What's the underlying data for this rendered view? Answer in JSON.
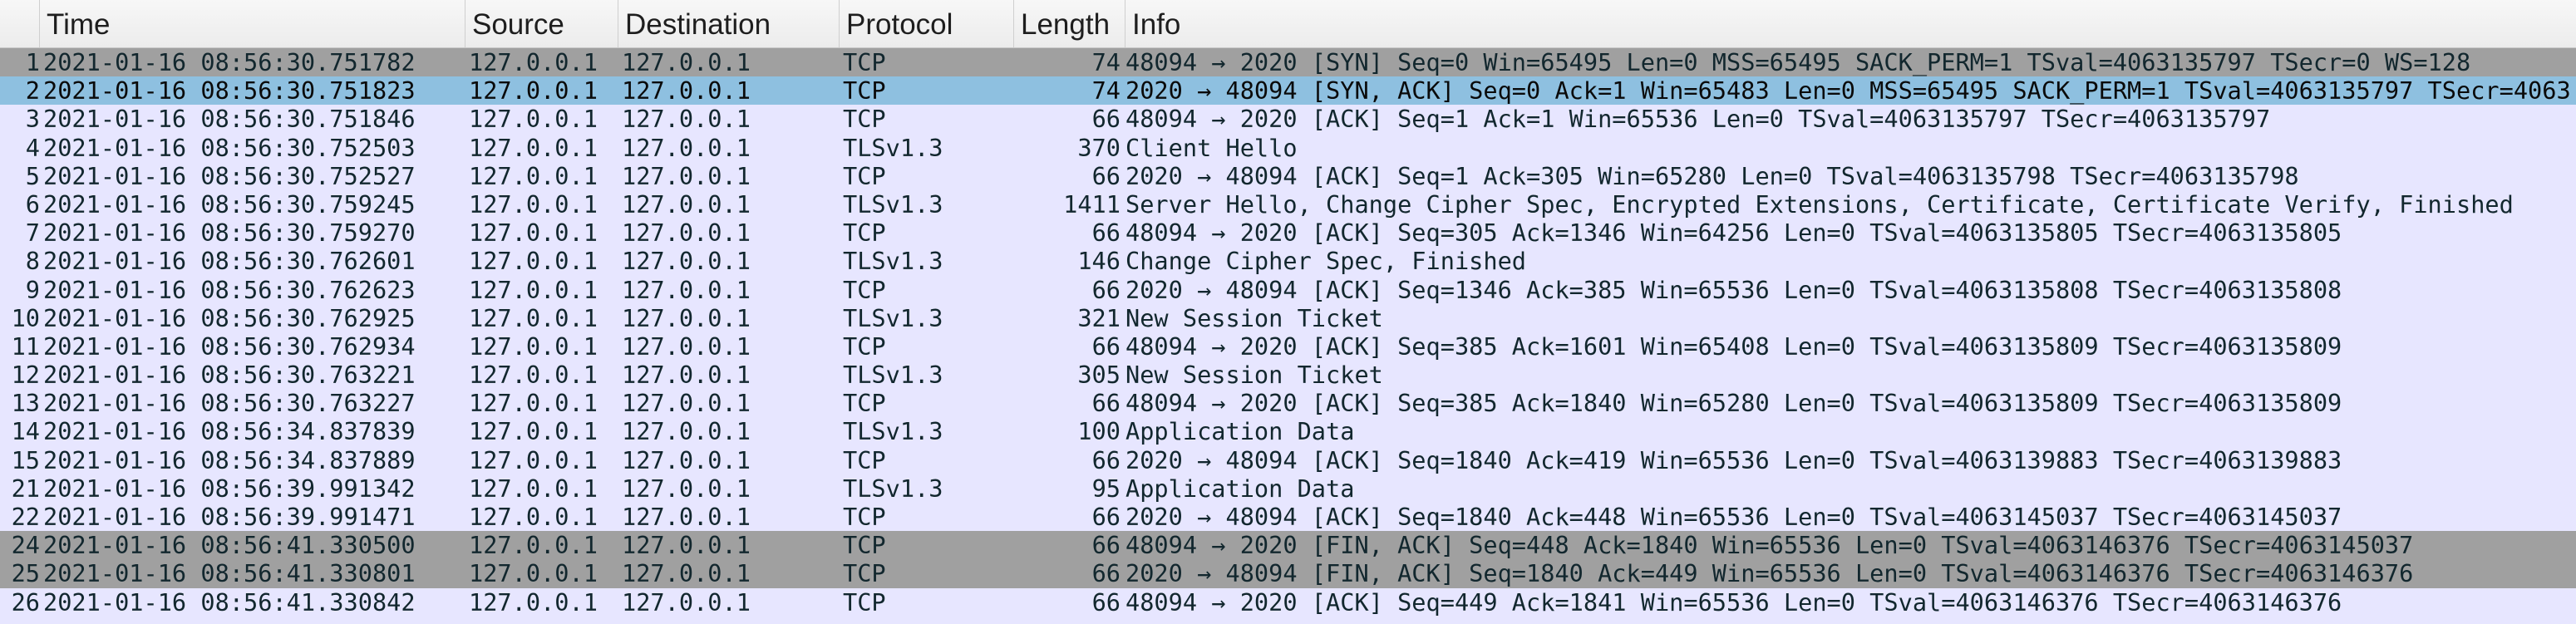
{
  "columns": {
    "no": "",
    "time": "Time",
    "source": "Source",
    "destination": "Destination",
    "protocol": "Protocol",
    "length": "Length",
    "info": "Info"
  },
  "colors": {
    "row_default": "#e7e6ff",
    "row_flag": "#a0a0a0",
    "row_selected": "#8ec0e0"
  },
  "packets": [
    {
      "no": "1",
      "time": "2021-01-16 08:56:30.751782",
      "source": "127.0.0.1",
      "destination": "127.0.0.1",
      "protocol": "TCP",
      "length": "74",
      "info": "48094 → 2020 [SYN] Seq=0 Win=65495 Len=0 MSS=65495 SACK_PERM=1 TSval=4063135797 TSecr=0 WS=128",
      "style": "flag"
    },
    {
      "no": "2",
      "time": "2021-01-16 08:56:30.751823",
      "source": "127.0.0.1",
      "destination": "127.0.0.1",
      "protocol": "TCP",
      "length": "74",
      "info": "2020 → 48094 [SYN, ACK] Seq=0 Ack=1 Win=65483 Len=0 MSS=65495 SACK_PERM=1 TSval=4063135797 TSecr=4063",
      "style": "selected"
    },
    {
      "no": "3",
      "time": "2021-01-16 08:56:30.751846",
      "source": "127.0.0.1",
      "destination": "127.0.0.1",
      "protocol": "TCP",
      "length": "66",
      "info": "48094 → 2020 [ACK] Seq=1 Ack=1 Win=65536 Len=0 TSval=4063135797 TSecr=4063135797",
      "style": "tcp"
    },
    {
      "no": "4",
      "time": "2021-01-16 08:56:30.752503",
      "source": "127.0.0.1",
      "destination": "127.0.0.1",
      "protocol": "TLSv1.3",
      "length": "370",
      "info": "Client Hello",
      "style": "tls"
    },
    {
      "no": "5",
      "time": "2021-01-16 08:56:30.752527",
      "source": "127.0.0.1",
      "destination": "127.0.0.1",
      "protocol": "TCP",
      "length": "66",
      "info": "2020 → 48094 [ACK] Seq=1 Ack=305 Win=65280 Len=0 TSval=4063135798 TSecr=4063135798",
      "style": "tcp"
    },
    {
      "no": "6",
      "time": "2021-01-16 08:56:30.759245",
      "source": "127.0.0.1",
      "destination": "127.0.0.1",
      "protocol": "TLSv1.3",
      "length": "1411",
      "info": "Server Hello, Change Cipher Spec, Encrypted Extensions, Certificate, Certificate Verify, Finished",
      "style": "tls"
    },
    {
      "no": "7",
      "time": "2021-01-16 08:56:30.759270",
      "source": "127.0.0.1",
      "destination": "127.0.0.1",
      "protocol": "TCP",
      "length": "66",
      "info": "48094 → 2020 [ACK] Seq=305 Ack=1346 Win=64256 Len=0 TSval=4063135805 TSecr=4063135805",
      "style": "tcp"
    },
    {
      "no": "8",
      "time": "2021-01-16 08:56:30.762601",
      "source": "127.0.0.1",
      "destination": "127.0.0.1",
      "protocol": "TLSv1.3",
      "length": "146",
      "info": "Change Cipher Spec, Finished",
      "style": "tls"
    },
    {
      "no": "9",
      "time": "2021-01-16 08:56:30.762623",
      "source": "127.0.0.1",
      "destination": "127.0.0.1",
      "protocol": "TCP",
      "length": "66",
      "info": "2020 → 48094 [ACK] Seq=1346 Ack=385 Win=65536 Len=0 TSval=4063135808 TSecr=4063135808",
      "style": "tcp"
    },
    {
      "no": "10",
      "time": "2021-01-16 08:56:30.762925",
      "source": "127.0.0.1",
      "destination": "127.0.0.1",
      "protocol": "TLSv1.3",
      "length": "321",
      "info": "New Session Ticket",
      "style": "tls"
    },
    {
      "no": "11",
      "time": "2021-01-16 08:56:30.762934",
      "source": "127.0.0.1",
      "destination": "127.0.0.1",
      "protocol": "TCP",
      "length": "66",
      "info": "48094 → 2020 [ACK] Seq=385 Ack=1601 Win=65408 Len=0 TSval=4063135809 TSecr=4063135809",
      "style": "tcp"
    },
    {
      "no": "12",
      "time": "2021-01-16 08:56:30.763221",
      "source": "127.0.0.1",
      "destination": "127.0.0.1",
      "protocol": "TLSv1.3",
      "length": "305",
      "info": "New Session Ticket",
      "style": "tls"
    },
    {
      "no": "13",
      "time": "2021-01-16 08:56:30.763227",
      "source": "127.0.0.1",
      "destination": "127.0.0.1",
      "protocol": "TCP",
      "length": "66",
      "info": "48094 → 2020 [ACK] Seq=385 Ack=1840 Win=65280 Len=0 TSval=4063135809 TSecr=4063135809",
      "style": "tcp"
    },
    {
      "no": "14",
      "time": "2021-01-16 08:56:34.837839",
      "source": "127.0.0.1",
      "destination": "127.0.0.1",
      "protocol": "TLSv1.3",
      "length": "100",
      "info": "Application Data",
      "style": "tls"
    },
    {
      "no": "15",
      "time": "2021-01-16 08:56:34.837889",
      "source": "127.0.0.1",
      "destination": "127.0.0.1",
      "protocol": "TCP",
      "length": "66",
      "info": "2020 → 48094 [ACK] Seq=1840 Ack=419 Win=65536 Len=0 TSval=4063139883 TSecr=4063139883",
      "style": "tcp"
    },
    {
      "no": "21",
      "time": "2021-01-16 08:56:39.991342",
      "source": "127.0.0.1",
      "destination": "127.0.0.1",
      "protocol": "TLSv1.3",
      "length": "95",
      "info": "Application Data",
      "style": "tls"
    },
    {
      "no": "22",
      "time": "2021-01-16 08:56:39.991471",
      "source": "127.0.0.1",
      "destination": "127.0.0.1",
      "protocol": "TCP",
      "length": "66",
      "info": "2020 → 48094 [ACK] Seq=1840 Ack=448 Win=65536 Len=0 TSval=4063145037 TSecr=4063145037",
      "style": "tcp"
    },
    {
      "no": "24",
      "time": "2021-01-16 08:56:41.330500",
      "source": "127.0.0.1",
      "destination": "127.0.0.1",
      "protocol": "TCP",
      "length": "66",
      "info": "48094 → 2020 [FIN, ACK] Seq=448 Ack=1840 Win=65536 Len=0 TSval=4063146376 TSecr=4063145037",
      "style": "flag"
    },
    {
      "no": "25",
      "time": "2021-01-16 08:56:41.330801",
      "source": "127.0.0.1",
      "destination": "127.0.0.1",
      "protocol": "TCP",
      "length": "66",
      "info": "2020 → 48094 [FIN, ACK] Seq=1840 Ack=449 Win=65536 Len=0 TSval=4063146376 TSecr=4063146376",
      "style": "flag"
    },
    {
      "no": "26",
      "time": "2021-01-16 08:56:41.330842",
      "source": "127.0.0.1",
      "destination": "127.0.0.1",
      "protocol": "TCP",
      "length": "66",
      "info": "48094 → 2020 [ACK] Seq=449 Ack=1841 Win=65536 Len=0 TSval=4063146376 TSecr=4063146376",
      "style": "tcp"
    }
  ]
}
